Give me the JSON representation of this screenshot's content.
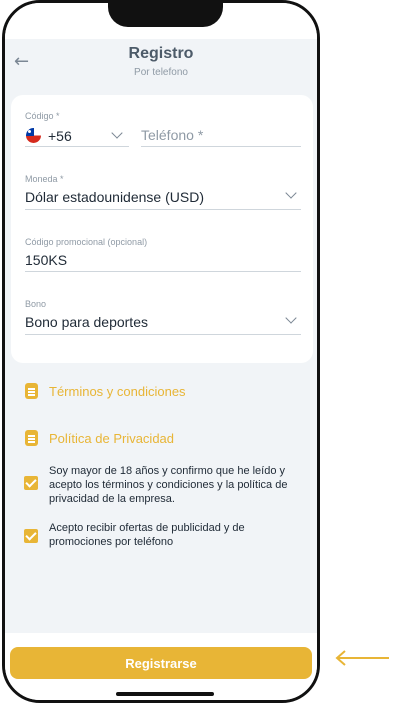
{
  "header": {
    "title": "Registro",
    "subtitle": "Por telefono",
    "back_icon": "arrow-left-icon"
  },
  "form": {
    "code": {
      "label": "Código *",
      "value": "+56",
      "flag": "chile-flag-icon"
    },
    "phone": {
      "placeholder": "Teléfono *"
    },
    "currency": {
      "label": "Moneda *",
      "value": "Dólar estadounidense (USD)"
    },
    "promo": {
      "label": "Código promocional (opcional)",
      "value": "150KS"
    },
    "bonus": {
      "label": "Bono",
      "value": "Bono para deportes"
    }
  },
  "links": {
    "terms": "Términos y condiciones",
    "privacy": "Política de Privacidad"
  },
  "checks": {
    "age": "Soy mayor de 18 años y confirmo que he leído y acepto los términos y condiciones y la política de privacidad de la empresa.",
    "offers": "Acepto recibir ofertas de publicidad y de promociones por teléfono"
  },
  "actions": {
    "register": "Registrarse"
  },
  "colors": {
    "accent": "#e8b536",
    "background": "#f1f4f7",
    "text": "#1f2a36"
  }
}
